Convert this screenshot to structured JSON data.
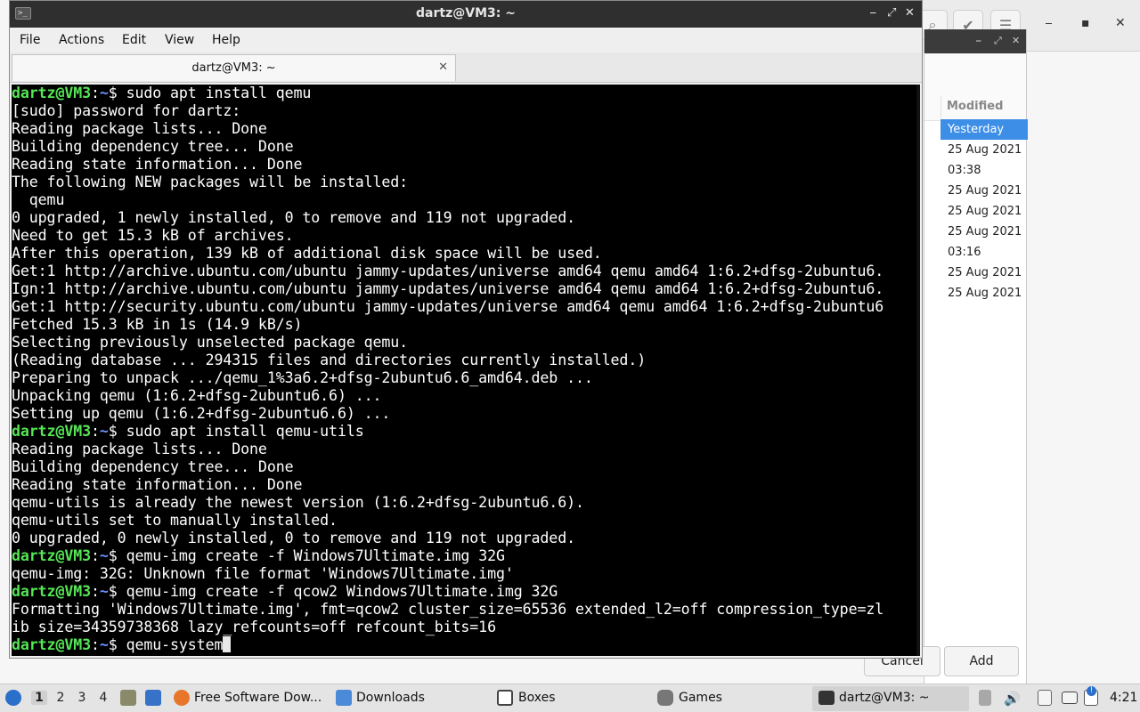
{
  "terminal_window": {
    "title": "dartz@VM3: ~",
    "controls": {
      "minimize": "⎯",
      "maximize": "⤢",
      "close": "✕"
    },
    "menu": [
      "File",
      "Actions",
      "Edit",
      "View",
      "Help"
    ],
    "tab": {
      "label": "dartz@VM3: ~",
      "close": "✕"
    },
    "prompt_user": "dartz@VM3",
    "prompt_sep": ":",
    "prompt_path": "~",
    "prompt_symbol": "$ ",
    "lines": [
      {
        "type": "prompt",
        "text": "sudo apt install qemu"
      },
      {
        "type": "out",
        "text": "[sudo] password for dartz:"
      },
      {
        "type": "out",
        "text": "Reading package lists... Done"
      },
      {
        "type": "out",
        "text": "Building dependency tree... Done"
      },
      {
        "type": "out",
        "text": "Reading state information... Done"
      },
      {
        "type": "out",
        "text": "The following NEW packages will be installed:"
      },
      {
        "type": "out",
        "text": "  qemu"
      },
      {
        "type": "out",
        "text": "0 upgraded, 1 newly installed, 0 to remove and 119 not upgraded."
      },
      {
        "type": "out",
        "text": "Need to get 15.3 kB of archives."
      },
      {
        "type": "out",
        "text": "After this operation, 139 kB of additional disk space will be used."
      },
      {
        "type": "out",
        "text": "Get:1 http://archive.ubuntu.com/ubuntu jammy-updates/universe amd64 qemu amd64 1:6.2+dfsg-2ubuntu6."
      },
      {
        "type": "out",
        "text": "Ign:1 http://archive.ubuntu.com/ubuntu jammy-updates/universe amd64 qemu amd64 1:6.2+dfsg-2ubuntu6."
      },
      {
        "type": "out",
        "text": "Get:1 http://security.ubuntu.com/ubuntu jammy-updates/universe amd64 qemu amd64 1:6.2+dfsg-2ubuntu6"
      },
      {
        "type": "out",
        "text": "Fetched 15.3 kB in 1s (14.9 kB/s)"
      },
      {
        "type": "out",
        "text": "Selecting previously unselected package qemu."
      },
      {
        "type": "out",
        "text": "(Reading database ... 294315 files and directories currently installed.)"
      },
      {
        "type": "out",
        "text": "Preparing to unpack .../qemu_1%3a6.2+dfsg-2ubuntu6.6_amd64.deb ..."
      },
      {
        "type": "out",
        "text": "Unpacking qemu (1:6.2+dfsg-2ubuntu6.6) ..."
      },
      {
        "type": "out",
        "text": "Setting up qemu (1:6.2+dfsg-2ubuntu6.6) ..."
      },
      {
        "type": "prompt",
        "text": "sudo apt install qemu-utils"
      },
      {
        "type": "out",
        "text": "Reading package lists... Done"
      },
      {
        "type": "out",
        "text": "Building dependency tree... Done"
      },
      {
        "type": "out",
        "text": "Reading state information... Done"
      },
      {
        "type": "out",
        "text": "qemu-utils is already the newest version (1:6.2+dfsg-2ubuntu6.6)."
      },
      {
        "type": "out",
        "text": "qemu-utils set to manually installed."
      },
      {
        "type": "out",
        "text": "0 upgraded, 0 newly installed, 0 to remove and 119 not upgraded."
      },
      {
        "type": "prompt",
        "text": "qemu-img create -f Windows7Ultimate.img 32G"
      },
      {
        "type": "out",
        "text": "qemu-img: 32G: Unknown file format 'Windows7Ultimate.img'"
      },
      {
        "type": "prompt",
        "text": "qemu-img create -f qcow2 Windows7Ultimate.img 32G"
      },
      {
        "type": "out",
        "text": "Formatting 'Windows7Ultimate.img', fmt=qcow2 cluster_size=65536 extended_l2=off compression_type=zl"
      },
      {
        "type": "out",
        "text": "ib size=34359738368 lazy_refcounts=off refcount_bits=16"
      },
      {
        "type": "current",
        "text": "qemu-system"
      }
    ]
  },
  "background_window": {
    "controls": {
      "minimize": "⎯",
      "maximize": "▪",
      "close": "✕"
    },
    "toolbar_icons": [
      "search-icon",
      "check-icon",
      "menu-icon"
    ],
    "dialog_controls": {
      "minimize": "⎯",
      "maximize": "⤢",
      "close": "✕"
    },
    "column_header": "Modified",
    "rows": [
      "Yesterday",
      "25 Aug 2021",
      "03:38",
      "25 Aug 2021",
      "25 Aug 2021",
      "25 Aug 2021",
      "03:16",
      "25 Aug 2021",
      "25 Aug 2021"
    ],
    "selected_row": 0,
    "cancel_label": "Cancel",
    "add_label": "Add"
  },
  "taskbar": {
    "workspaces": [
      "1",
      "2",
      "3",
      "4"
    ],
    "active_workspace": 0,
    "tasks": [
      {
        "icon": "firefox-icon",
        "label": "Free Software Dow..."
      },
      {
        "icon": "folder-icon",
        "label": "Downloads"
      },
      {
        "icon": "boxes-icon",
        "label": "Boxes"
      },
      {
        "icon": "gamepad-icon",
        "label": "Games"
      },
      {
        "icon": "terminal-icon",
        "label": "dartz@VM3: ~"
      }
    ],
    "clock": "4:21",
    "notification_badge": "!"
  },
  "colors": {
    "prompt_user": "#55e655",
    "prompt_path": "#6f8fff",
    "selection": "#3d8ee6",
    "terminal_bg": "#000000"
  }
}
